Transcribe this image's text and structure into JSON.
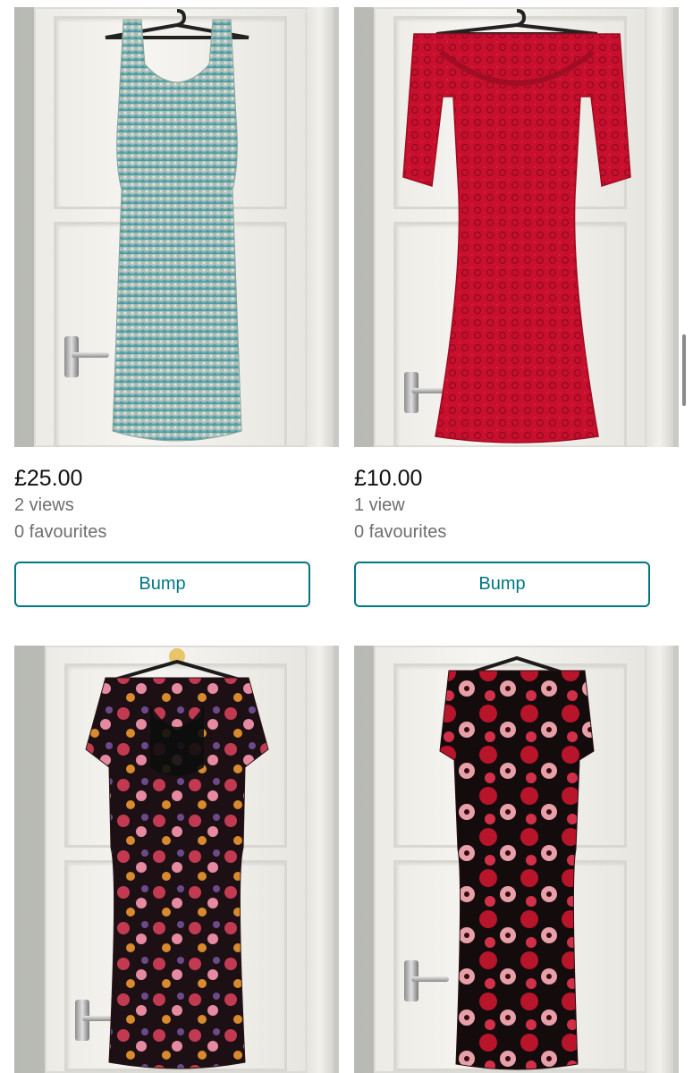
{
  "listings": [
    {
      "price": "£25.00",
      "views": "2 views",
      "favourites": "0 favourites",
      "bump_label": "Bump",
      "photo": "sequinned sage and teal dress on hanger"
    },
    {
      "price": "£10.00",
      "views": "1 view",
      "favourites": "0 favourites",
      "bump_label": "Bump",
      "photo": "red lace off-shoulder dress on hanger"
    },
    {
      "photo": "dark floral print sweetheart dress on hanger"
    },
    {
      "photo": "black and red rose print dress on hanger"
    }
  ],
  "colors": {
    "accent": "#007782",
    "price_text": "#111111",
    "meta_text": "#6e6e6e"
  }
}
